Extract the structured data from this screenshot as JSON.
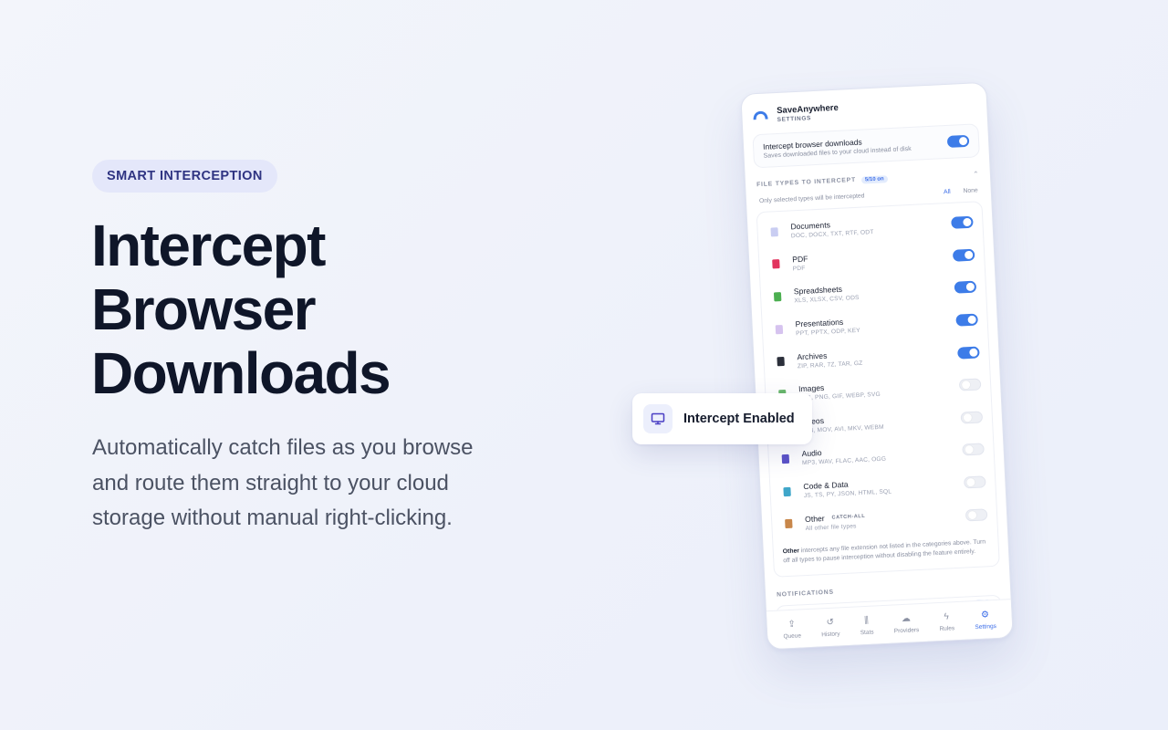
{
  "hero": {
    "badge": "SMART INTERCEPTION",
    "headline": [
      "Intercept",
      "Browser",
      "Downloads"
    ],
    "body": "Automatically catch files as you browse and route them straight to your cloud storage without manual right-clicking."
  },
  "app": {
    "name": "SaveAnywhere",
    "subtitle": "SETTINGS",
    "main_toggle": {
      "title": "Intercept browser downloads",
      "description": "Saves downloaded files to your cloud instead of disk",
      "on": true
    },
    "file_types": {
      "title": "FILE TYPES TO INTERCEPT",
      "count": "5/10 on",
      "hint": "Only selected types will be intercepted",
      "all_label": "All",
      "none_label": "None",
      "items": [
        {
          "name": "Documents",
          "ext": "DOC, DOCX, TXT, RTF, ODT",
          "on": true,
          "icon": "document-icon",
          "color": "#c9cdf2"
        },
        {
          "name": "PDF",
          "ext": "PDF",
          "on": true,
          "icon": "pdf-icon",
          "color": "#e2345e"
        },
        {
          "name": "Spreadsheets",
          "ext": "XLS, XLSX, CSV, ODS",
          "on": true,
          "icon": "spreadsheet-icon",
          "color": "#4caf50"
        },
        {
          "name": "Presentations",
          "ext": "PPT, PPTX, ODP, KEY",
          "on": true,
          "icon": "presentation-icon",
          "color": "#d6c3ef"
        },
        {
          "name": "Archives",
          "ext": "ZIP, RAR, 7Z, TAR, GZ",
          "on": true,
          "icon": "archive-icon",
          "color": "#2b2f3a"
        },
        {
          "name": "Images",
          "ext": "JPG, PNG, GIF, WEBP, SVG",
          "on": false,
          "icon": "image-icon",
          "color": "#69b86b"
        },
        {
          "name": "Videos",
          "ext": "MP4, MOV, AVI, MKV, WEBM",
          "on": false,
          "icon": "video-icon",
          "color": "#5a6070"
        },
        {
          "name": "Audio",
          "ext": "MP3, WAV, FLAC, AAC, OGG",
          "on": false,
          "icon": "music-icon",
          "color": "#5b52c8"
        },
        {
          "name": "Code & Data",
          "ext": "JS, TS, PY, JSON, HTML, SQL",
          "on": false,
          "icon": "code-icon",
          "color": "#3fa6c9"
        },
        {
          "name": "Other",
          "badge": "CATCH-ALL",
          "ext": "All other file types",
          "on": false,
          "icon": "package-icon",
          "color": "#c8874a"
        }
      ],
      "note_bold": "Other",
      "note": " intercepts any file extension not listed in the categories above. Turn off all types to pause interception without disabling the feature entirely."
    },
    "notifications_title": "NOTIFICATIONS",
    "tabs": [
      {
        "label": "Queue",
        "icon": "upload-icon",
        "glyph": "⇪",
        "active": false
      },
      {
        "label": "History",
        "icon": "history-icon",
        "glyph": "↺",
        "active": false
      },
      {
        "label": "Stats",
        "icon": "stats-icon",
        "glyph": "⫼",
        "active": false
      },
      {
        "label": "Providers",
        "icon": "cloud-icon",
        "glyph": "☁",
        "active": false
      },
      {
        "label": "Rules",
        "icon": "bolt-icon",
        "glyph": "ϟ",
        "active": false
      },
      {
        "label": "Settings",
        "icon": "gear-icon",
        "glyph": "⚙",
        "active": true
      }
    ]
  },
  "toast": {
    "label": "Intercept Enabled",
    "icon": "monitor-icon"
  },
  "colors": {
    "accent": "#3d7ce8",
    "badge_bg": "#e4e7fa",
    "badge_text": "#2f3482"
  }
}
